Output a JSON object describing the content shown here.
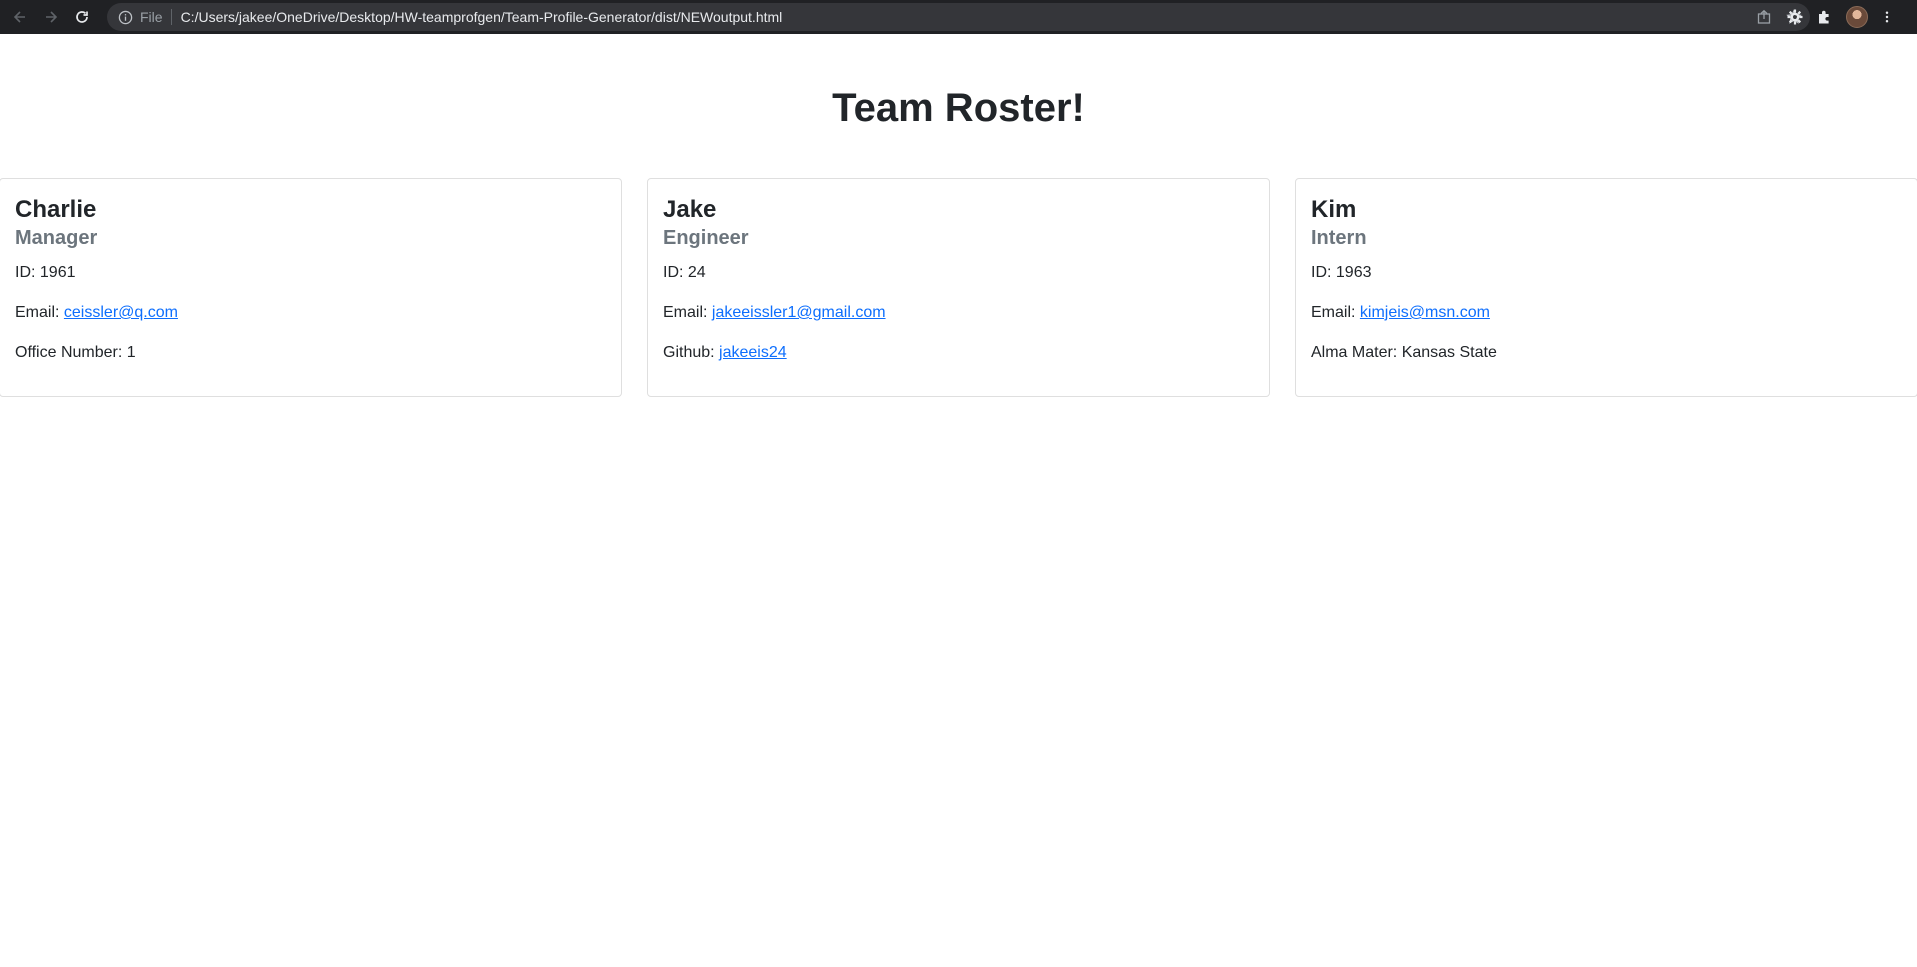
{
  "browser": {
    "scheme_label": "File",
    "url": "C:/Users/jakee/OneDrive/Desktop/HW-teamprofgen/Team-Profile-Generator/dist/NEWoutput.html"
  },
  "page": {
    "title": "Team Roster!"
  },
  "cards": [
    {
      "name": "Charlie",
      "role": "Manager",
      "id_label": "ID: 1961",
      "email_label": "Email:",
      "email": "ceissler@q.com",
      "extra_label": "Office Number: 1",
      "extra_link": ""
    },
    {
      "name": "Jake",
      "role": "Engineer",
      "id_label": "ID: 24",
      "email_label": "Email:",
      "email": "jakeeissler1@gmail.com",
      "extra_label": "Github:",
      "extra_link": "jakeeis24"
    },
    {
      "name": "Kim",
      "role": "Intern",
      "id_label": "ID: 1963",
      "email_label": "Email:",
      "email": "kimjeis@msn.com",
      "extra_label": "Alma Mater: Kansas State",
      "extra_link": ""
    }
  ],
  "colors": {
    "link": "#0d6efd",
    "subtitle": "#6c757d",
    "chrome": "#202124"
  }
}
